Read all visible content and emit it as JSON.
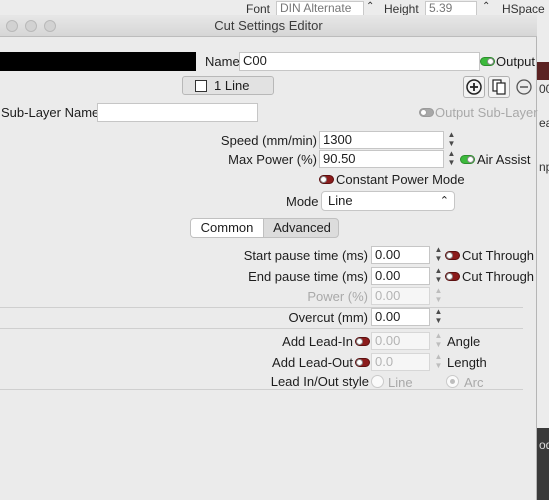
{
  "background_app": {
    "font_label": "Font",
    "font_value": "DIN Alternate",
    "height_label": "Height",
    "height_value": "5.39",
    "hspace_label": "HSpace",
    "fragments": [
      "00",
      "ea",
      "np",
      "od"
    ]
  },
  "window": {
    "title": "Cut Settings Editor"
  },
  "name": {
    "label": "Name",
    "value": "C00"
  },
  "output": {
    "label": "Output",
    "enabled": true
  },
  "layer_button": {
    "label": "1 Line"
  },
  "toolbar": {
    "add_icon": "plus-circle-icon",
    "copy_icon": "copy-icon",
    "remove_icon": "minus-circle-icon"
  },
  "sub_layer": {
    "label": "Sub-Layer Name",
    "value": ""
  },
  "output_sub_layer": {
    "label": "Output Sub-Layer",
    "enabled": false
  },
  "speed": {
    "label": "Speed (mm/min)",
    "value": "1300"
  },
  "max_power": {
    "label": "Max Power (%)",
    "value": "90.50"
  },
  "air_assist": {
    "label": "Air Assist",
    "enabled": true
  },
  "constant_power": {
    "label": "Constant Power Mode",
    "enabled": false
  },
  "mode": {
    "label": "Mode",
    "value": "Line"
  },
  "tabs": [
    {
      "label": "Common",
      "selected": true
    },
    {
      "label": "Advanced",
      "selected": false
    }
  ],
  "start_pause": {
    "label": "Start pause time (ms)",
    "value": "0.00",
    "cut_through_label": "Cut Through"
  },
  "end_pause": {
    "label": "End pause time (ms)",
    "value": "0.00",
    "cut_through_label": "Cut Through"
  },
  "power": {
    "label": "Power (%)",
    "value": "0.00"
  },
  "overcut": {
    "label": "Overcut (mm)",
    "value": "0.00"
  },
  "lead_in": {
    "label": "Add Lead-In",
    "value": "0.00",
    "unit_label": "Angle",
    "enabled": false
  },
  "lead_out": {
    "label": "Add Lead-Out",
    "value": "0.0",
    "unit_label": "Length",
    "enabled": false
  },
  "lead_style": {
    "label": "Lead In/Out style",
    "options": [
      "Line",
      "Arc"
    ],
    "selected": "Arc"
  },
  "colors": {
    "on": "#3cba3c",
    "off": "#8b1c1c",
    "accent_dark": "#5b2222"
  }
}
